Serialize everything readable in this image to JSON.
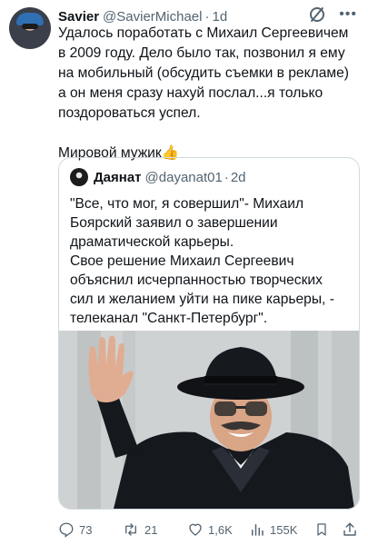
{
  "author": {
    "name": "Savier",
    "handle": "@SavierMichael",
    "time": "1d"
  },
  "tweet": {
    "text": "Удалось поработать с Михаил Сергеевичем\nв 2009 году. Дело было так, позвонил я ему\nна мобильный (обсудить съемки в рекламе)\nа он меня сразу нахуй послал...я только\nпоздороваться успел.\n\nМировой мужик👍"
  },
  "quoted": {
    "name": "Даянат",
    "handle": "@dayanat01",
    "time": "2d",
    "text": "\"Все, что мог, я совершил\"- Михаил\nБоярский заявил о завершении\nдраматической карьеры.\nСвое решение Михаил Сергеевич\nобъяснил исчерпанностью творческих\nсил и желанием уйти на пике карьеры, -\nтелеканал \"Санкт-Петербург\"."
  },
  "actions": {
    "replies": "73",
    "retweets": "21",
    "likes": "1,6K",
    "views": "155K"
  },
  "icons": {
    "reply": "reply-icon",
    "retweet": "retweet-icon",
    "like": "heart-icon",
    "views": "views-icon",
    "bookmark": "bookmark-icon",
    "share": "share-icon",
    "grok": "grok-icon",
    "more": "more-icon"
  },
  "colors": {
    "text": "#0f1419",
    "secondary": "#536471",
    "border": "#cfd9de"
  }
}
